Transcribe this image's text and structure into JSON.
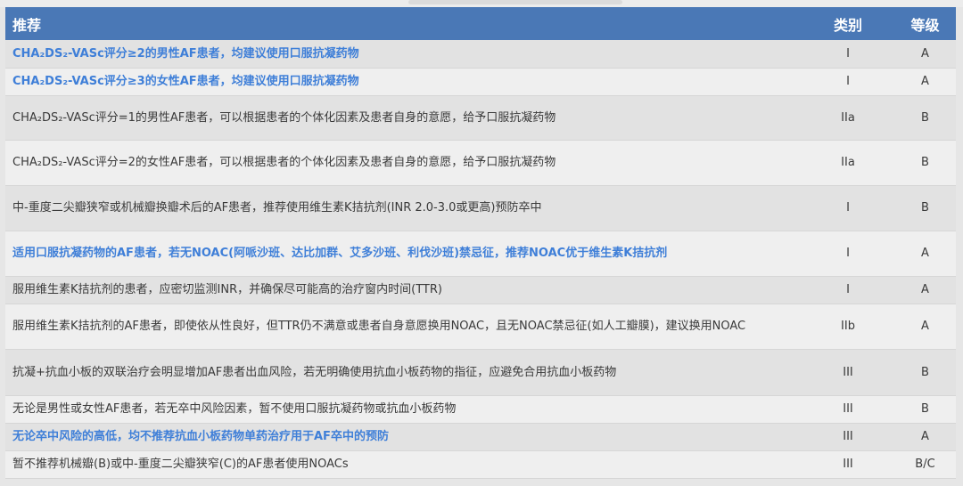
{
  "header": {
    "recommendation": "推荐",
    "class": "类别",
    "level": "等级"
  },
  "rows": [
    {
      "text": "CHA₂DS₂-VASc评分≥2的男性AF患者，均建议使用口服抗凝药物",
      "class": "I",
      "level": "A",
      "highlight": true
    },
    {
      "text": "CHA₂DS₂-VASc评分≥3的女性AF患者，均建议使用口服抗凝药物",
      "class": "I",
      "level": "A",
      "highlight": true
    },
    {
      "text": "CHA₂DS₂-VASc评分=1的男性AF患者，可以根据患者的个体化因素及患者自身的意愿，给予口服抗凝药物",
      "class": "IIa",
      "level": "B",
      "highlight": false
    },
    {
      "text": "CHA₂DS₂-VASc评分=2的女性AF患者，可以根据患者的个体化因素及患者自身的意愿，给予口服抗凝药物",
      "class": "IIa",
      "level": "B",
      "highlight": false
    },
    {
      "text": "中-重度二尖瓣狭窄或机械瓣换瓣术后的AF患者，推荐使用维生素K拮抗剂(INR 2.0-3.0或更高)预防卒中",
      "class": "I",
      "level": "B",
      "highlight": false
    },
    {
      "text": "适用口服抗凝药物的AF患者，若无NOAC(阿哌沙班、达比加群、艾多沙班、利伐沙班)禁忌征，推荐NOAC优于维生素K拮抗剂",
      "class": "I",
      "level": "A",
      "highlight": true
    },
    {
      "text": "服用维生素K拮抗剂的患者，应密切监测INR，并确保尽可能高的治疗窗内时间(TTR)",
      "class": "I",
      "level": "A",
      "highlight": false
    },
    {
      "text": "服用维生素K拮抗剂的AF患者，即使依从性良好，但TTR仍不满意或患者自身意愿换用NOAC，且无NOAC禁忌征(如人工瓣膜)，建议换用NOAC",
      "class": "IIb",
      "level": "A",
      "highlight": false
    },
    {
      "text": "抗凝+抗血小板的双联治疗会明显增加AF患者出血风险，若无明确使用抗血小板药物的指征，应避免合用抗血小板药物",
      "class": "III",
      "level": "B",
      "highlight": false
    },
    {
      "text": "无论是男性或女性AF患者，若无卒中风险因素，暂不使用口服抗凝药物或抗血小板药物",
      "class": "III",
      "level": "B",
      "highlight": false
    },
    {
      "text": "无论卒中风险的高低，均不推荐抗血小板药物单药治疗用于AF卒中的预防",
      "class": "III",
      "level": "A",
      "highlight": true
    },
    {
      "text": "暂不推荐机械瓣(B)或中-重度二尖瓣狭窄(C)的AF患者使用NOACs",
      "class": "III",
      "level": "B/C",
      "highlight": false
    }
  ],
  "colors": {
    "header_bg": "#4a78b6",
    "highlight_text": "#3f7fd8",
    "body_text": "#3a3a3a"
  }
}
